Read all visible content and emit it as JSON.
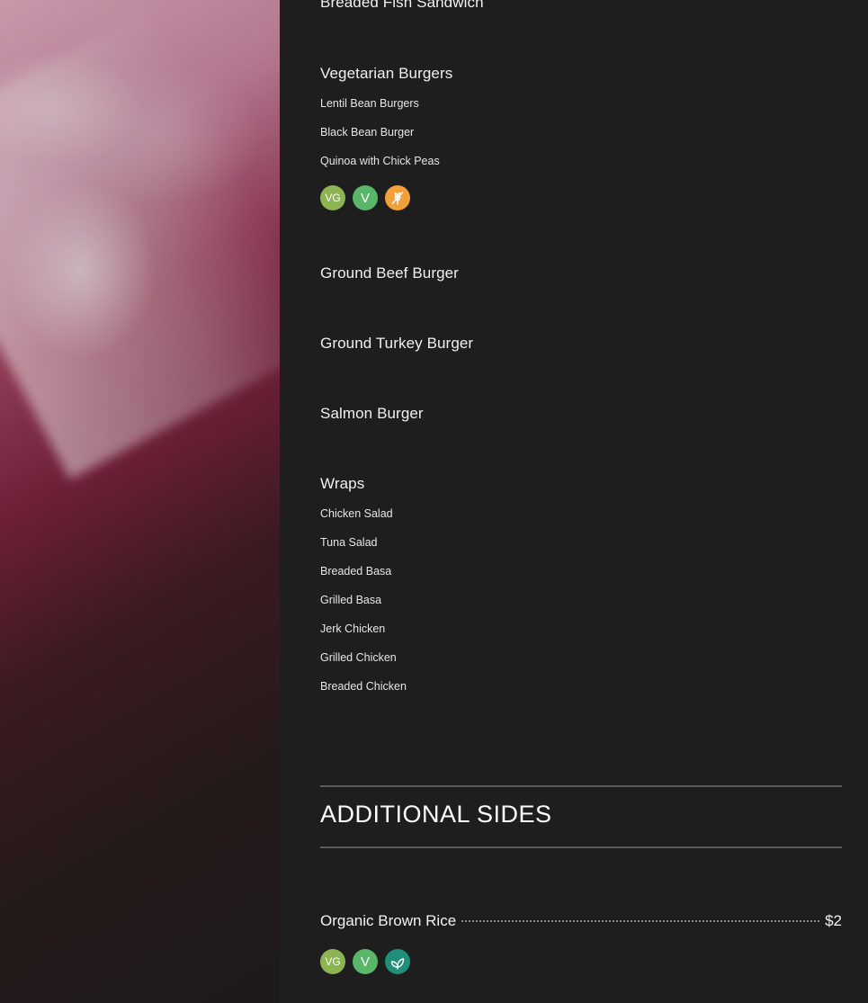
{
  "top_item": "Breaded Fish Sandwich",
  "vegetarian": {
    "title": "Vegetarian Burgers",
    "items": [
      "Lentil Bean Burgers",
      "Black Bean Burger",
      "Quinoa with Chick Peas"
    ],
    "badges": [
      {
        "label": "VG",
        "icon": "vegan-badge",
        "color": "#8cb451"
      },
      {
        "label": "V",
        "icon": "vegetarian-badge",
        "color": "#5ab76a"
      },
      {
        "label": "",
        "icon": "gluten-free-icon",
        "color": "#f2a03a"
      }
    ]
  },
  "burgers": [
    "Ground Beef Burger",
    "Ground Turkey Burger",
    "Salmon Burger"
  ],
  "wraps": {
    "title": "Wraps",
    "items": [
      "Chicken Salad",
      "Tuna Salad",
      "Breaded Basa",
      "Grilled Basa",
      "Jerk Chicken",
      "Grilled Chicken",
      "Breaded Chicken"
    ]
  },
  "additional_sides": {
    "title": "ADDITIONAL SIDES",
    "items": [
      {
        "name": "Organic Brown Rice",
        "price": "$2",
        "badges": [
          {
            "label": "VG",
            "icon": "vegan-badge",
            "color": "#8cb451"
          },
          {
            "label": "V",
            "icon": "vegetarian-badge",
            "color": "#5ab76a"
          },
          {
            "label": "",
            "icon": "organic-leaf-icon",
            "color": "#1f8f7a"
          }
        ]
      }
    ]
  }
}
